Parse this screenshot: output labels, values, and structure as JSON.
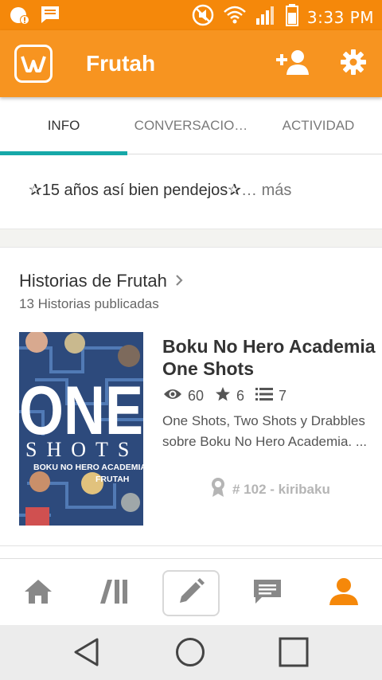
{
  "status_bar": {
    "time": "3:33 PM",
    "icons": [
      "notification-badge-icon",
      "message-icon",
      "mute-icon",
      "wifi-icon",
      "signal-icon",
      "battery-icon"
    ]
  },
  "app_bar": {
    "logo_icon": "wattpad-logo",
    "title": "Frutah",
    "actions": [
      "follow-user-icon",
      "settings-icon"
    ],
    "color": "#f79420"
  },
  "tabs": [
    {
      "label": "INFO",
      "active": true
    },
    {
      "label": "CONVERSACIO…",
      "active": false
    },
    {
      "label": "ACTIVIDAD",
      "active": false
    }
  ],
  "accent_color": "#16a8a8",
  "bio": {
    "text": "✰15 años así bien pendejos✰",
    "more": "… más"
  },
  "stories": {
    "title": "Historias de Frutah",
    "subtitle": "13 Historias publicadas",
    "items": [
      {
        "title": "Boku No Hero Academia One Shots",
        "views": "60",
        "votes": "6",
        "parts": "7",
        "description": "One Shots, Two Shots y Drabbles sobre Boku No Hero Academia. ...",
        "rank": "# 102 - kiribaku",
        "cover": {
          "big_text": "ONE",
          "sub_text": "SHOTS",
          "line1": "BOKU NO HERO ACADEMIA",
          "line2": "FRUTAH"
        }
      }
    ]
  },
  "bottom_nav": [
    "home-icon",
    "library-icon",
    "write-icon",
    "messages-icon",
    "profile-icon"
  ],
  "system_nav": [
    "back-icon",
    "home-circle-icon",
    "recents-icon"
  ]
}
